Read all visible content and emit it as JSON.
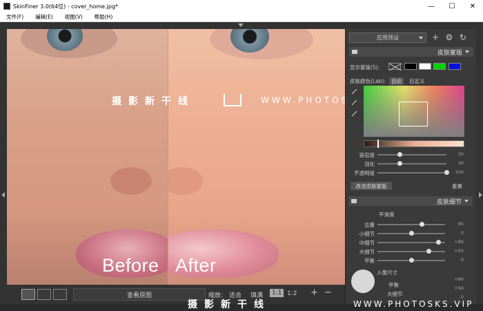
{
  "window": {
    "title": "SkinFiner 3.0(64位) - cover_home.jpg*",
    "minimize": "—",
    "maximize": "☐",
    "close": "✕"
  },
  "menu": [
    "文件(F)",
    "编辑(E)",
    "视图(V)",
    "帮助(H)"
  ],
  "image": {
    "before_label": "Before",
    "after_label": "After",
    "watermark_cn": "摄影新干线",
    "watermark_en": "WWW.PHOTOSKS.VIP"
  },
  "bottom": {
    "view_original": "查看原图",
    "zoom_label": "缩放:",
    "zoom_fit": "适合",
    "zoom_fill": "填满",
    "zoom_1": "1:1",
    "zoom_2": "1:2",
    "zoom_in": "+",
    "zoom_out": "−"
  },
  "panel": {
    "preset": "应用预设",
    "skin_mask": {
      "title": "皮肤蒙版",
      "show_mask": "显示蒙版(S):",
      "skin_color": "皮肤颜色(Lab):",
      "auto": "自动",
      "custom": "自定义",
      "swatch_colors": [
        "#000000",
        "#ffffff",
        "#00d400",
        "#0010e0"
      ],
      "sliders": [
        {
          "label": "容忍度",
          "value": "30",
          "fraction": 0.32
        },
        {
          "label": "羽化",
          "value": "30",
          "fraction": 0.32
        },
        {
          "label": "不透明度",
          "value": "100",
          "fraction": 1.0
        }
      ],
      "enhance": "改进皮肤蒙版",
      "reset": "重置"
    },
    "skin_detail": {
      "title": "皮肤细节",
      "smoothness": "平滑度",
      "sliders": [
        {
          "label": "总量",
          "value": "65",
          "fraction": 0.65
        },
        {
          "label": "小细节",
          "value": "0",
          "fraction": 0.5
        },
        {
          "label": "中细节",
          "value": "+80",
          "fraction": 0.9
        },
        {
          "label": "大细节",
          "value": "+50",
          "fraction": 0.75
        },
        {
          "label": "平衡",
          "value": "0",
          "fraction": 0.5
        }
      ],
      "portrait_size": "人像尺寸",
      "balance2": "平衡",
      "large_detail2": "大细节",
      "value_a": "+80",
      "value_b": "+50",
      "value_c": "0"
    }
  }
}
